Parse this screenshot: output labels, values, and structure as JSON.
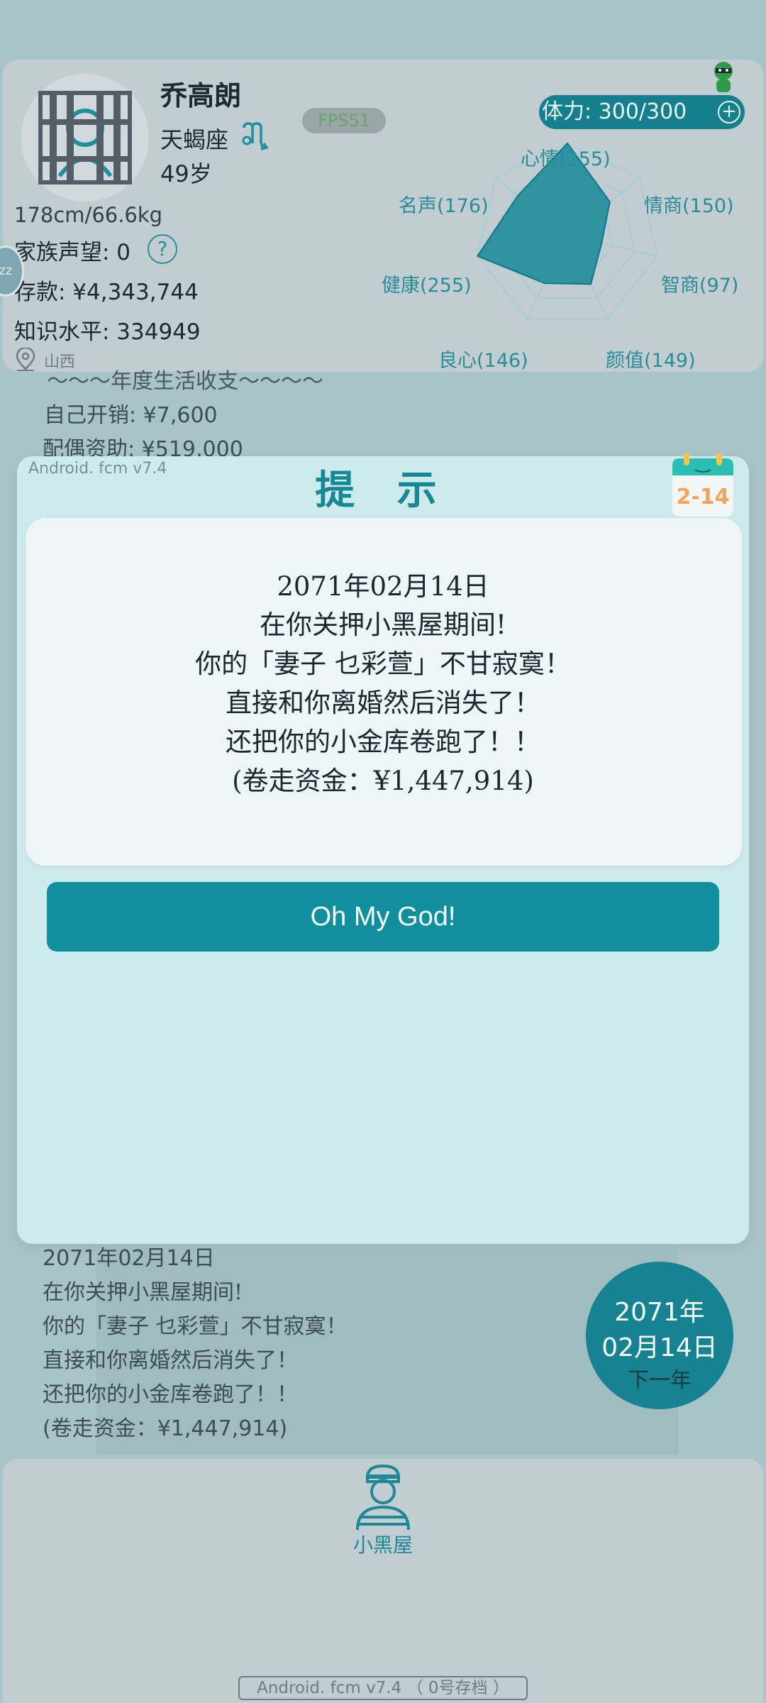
{
  "profile": {
    "name": "乔高朗",
    "zodiac": "天蝎座",
    "age": "49岁",
    "height_weight": "178cm/66.6kg",
    "fame": "家族声望: 0",
    "help": "?",
    "savings": "存款: ¥4,343,744",
    "knowledge": "知识水平: 334949",
    "location": "山西",
    "avatar_icon": "prisoner-avatar-icon"
  },
  "fps": "FPS51",
  "stamina": {
    "label": "体力: 300/300",
    "plus": "+"
  },
  "side_handle": "zz",
  "radar": {
    "labels": {
      "mood": "心情(255)",
      "emotional": "情商(150)",
      "iq": "智商(97)",
      "looks": "颜值(149)",
      "conscience": "良心(146)",
      "health": "健康(255)",
      "fame": "名声(176)"
    },
    "values": [
      255,
      150,
      97,
      149,
      146,
      255,
      176
    ],
    "max": 255,
    "color": "#168896"
  },
  "background_summary": {
    "line1": "～～～年度生活收支～～～～",
    "line2": "自己开销: ¥7,600",
    "line3": "配偶资助: ¥519,000"
  },
  "modal": {
    "version": "Android. fcm v7.4",
    "title": "提 示",
    "calendar": "2-14",
    "lines": [
      "2071年02月14日",
      "在你关押小黑屋期间!",
      "你的「妻子 乜彩萱」不甘寂寞！",
      "直接和你离婚然后消失了！",
      "还把你的小金库卷跑了！！",
      "(卷走资金：¥1,447,914)"
    ],
    "button": "Oh My God!"
  },
  "log": [
    "2071年02月14日",
    "在你关押小黑屋期间!",
    "你的「妻子 乜彩萱」不甘寂寞！",
    "直接和你离婚然后消失了！",
    "还把你的小金库卷跑了！！",
    "(卷走资金：¥1,447,914)"
  ],
  "next_year": {
    "year": "2071年",
    "date": "02月14日",
    "label": "下一年"
  },
  "bottom": {
    "jail_label": "小黑屋"
  },
  "footer": "Android. fcm v7.4 （ 0号存档 ）"
}
